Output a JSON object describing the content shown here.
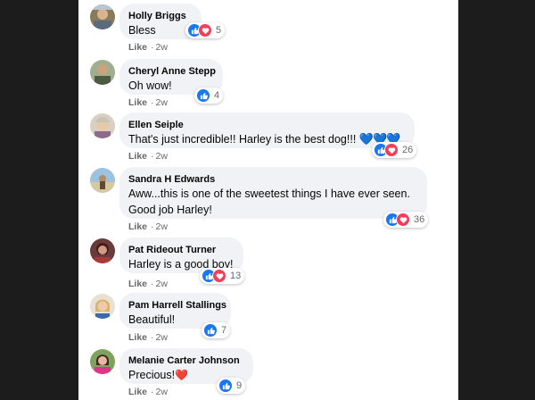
{
  "comments": [
    {
      "author": "Holly Briggs",
      "text": "Bless",
      "reactions": [
        "like",
        "love"
      ],
      "count": "5",
      "like_label": "Like",
      "dot": "·",
      "time": "2w"
    },
    {
      "author": "Cheryl Anne Stepp",
      "text": "Oh wow!",
      "reactions": [
        "like"
      ],
      "count": "4",
      "like_label": "Like",
      "dot": "·",
      "time": "2w"
    },
    {
      "author": "Ellen Seiple",
      "text": "That's just incredible!! Harley is the best dog!!!",
      "emoji": "💙💙💙",
      "reactions": [
        "like",
        "love"
      ],
      "count": "26",
      "like_label": "Like",
      "dot": "·",
      "time": "2w"
    },
    {
      "author": "Sandra H Edwards",
      "text": "Aww...this is one of the sweetest things I have ever seen. Good job Harley!",
      "reactions": [
        "like",
        "love"
      ],
      "count": "36",
      "like_label": "Like",
      "dot": "·",
      "time": "2w"
    },
    {
      "author": "Pat Rideout Turner",
      "text": "Harley is a good boy!",
      "reactions": [
        "like",
        "love"
      ],
      "count": "13",
      "like_label": "Like",
      "dot": "·",
      "time": "2w"
    },
    {
      "author": "Pam Harrell Stallings",
      "text": "Beautiful!",
      "reactions": [
        "like"
      ],
      "count": "7",
      "like_label": "Like",
      "dot": "·",
      "time": "2w"
    },
    {
      "author": "Melanie Carter Johnson",
      "text": "Precious!",
      "emoji": "❤️",
      "reactions": [
        "like"
      ],
      "count": "9",
      "like_label": "Like",
      "dot": "·",
      "time": "2w"
    }
  ],
  "colors": {
    "like": "#1877f2",
    "love": "#f33e58",
    "bubble": "#f0f2f5",
    "meta": "#65676b"
  }
}
